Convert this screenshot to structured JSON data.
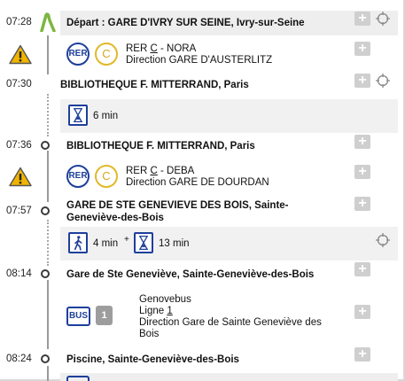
{
  "steps": [
    {
      "time": "07:28",
      "name": "Départ : GARE D'IVRY SUR SEINE, Ivry-sur-Seine"
    },
    {
      "time": "07:30",
      "name": "BIBLIOTHEQUE F. MITTERRAND, Paris"
    },
    {
      "time": "07:36",
      "name": "BIBLIOTHEQUE F. MITTERRAND, Paris"
    },
    {
      "time": "07:57",
      "name_line1": "GARE DE STE GENEVIEVE DES BOIS, Sainte-",
      "name_line2": "Geneviève-des-Bois"
    },
    {
      "time": "08:14",
      "name": "Gare de Ste Geneviève, Sainte-Geneviève-des-Bois"
    },
    {
      "time": "08:24",
      "name": "Piscine, Sainte-Geneviève-des-Bois"
    }
  ],
  "sections": {
    "rer_nora": {
      "mode": "RER",
      "line": "C",
      "mission": " - NORA",
      "direction": "Direction GARE D'AUSTERLITZ"
    },
    "wait_1": {
      "duration": "6 min"
    },
    "rer_deba": {
      "mode": "RER",
      "line": "C",
      "mission": " - DEBA",
      "direction": "Direction GARE DE DOURDAN"
    },
    "walk_wait": {
      "walk": "4 min",
      "plus": "+",
      "wait": "13 min"
    },
    "bus": {
      "mode": "BUS",
      "badge": "1",
      "network": "Genovebus",
      "line_prefix": "Ligne ",
      "line": "1",
      "direction": "Direction Gare de Sainte Geneviève des Bois"
    }
  },
  "controls": {
    "add": "+"
  },
  "icons": [
    "start-flag-icon",
    "warning-icon",
    "rer-icon",
    "line-c-icon",
    "hourglass-icon",
    "walk-icon",
    "bus-icon",
    "target-icon",
    "add-icon"
  ],
  "colors": {
    "accent_blue": "#1e3f9b",
    "line_c_yellow": "#e0b929",
    "start_green": "#7db642",
    "warning": "#f0b400"
  }
}
